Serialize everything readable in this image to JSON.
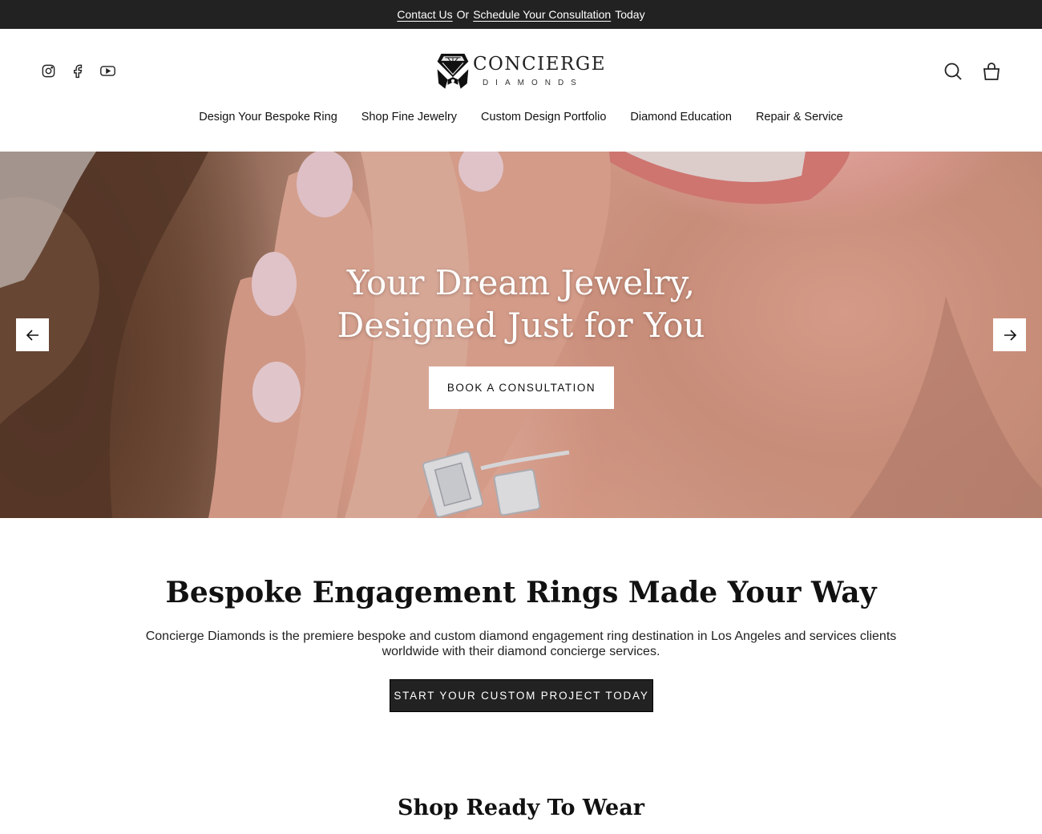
{
  "announcement": {
    "contact_link": "Contact Us",
    "or_text": "Or",
    "schedule_link": "Schedule Your Consultation",
    "today_text": "Today"
  },
  "header": {
    "logo_name": "CONCIERGE",
    "logo_sub": "DIAMONDS",
    "social_icons": [
      "instagram-icon",
      "facebook-icon",
      "youtube-icon"
    ],
    "action_icons": [
      "search-icon",
      "cart-icon"
    ]
  },
  "nav": {
    "items": [
      "Design Your Bespoke Ring",
      "Shop Fine Jewelry",
      "Custom Design Portfolio",
      "Diamond Education",
      "Repair & Service"
    ]
  },
  "hero": {
    "title_line1": "Your Dream Jewelry,",
    "title_line2": "Designed Just for You",
    "cta": "BOOK A CONSULTATION"
  },
  "intro": {
    "title": "Bespoke Engagement Rings Made Your Way",
    "text": "Concierge Diamonds is the premiere bespoke and custom diamond engagement ring destination in Los Angeles and services clients worldwide with their diamond concierge services.",
    "cta": "START YOUR CUSTOM PROJECT TODAY"
  },
  "shop": {
    "title": "Shop Ready To Wear"
  },
  "colors": {
    "announcement_bg": "#222222",
    "cta_dark": "#222222",
    "hero_text": "#ffffff"
  }
}
